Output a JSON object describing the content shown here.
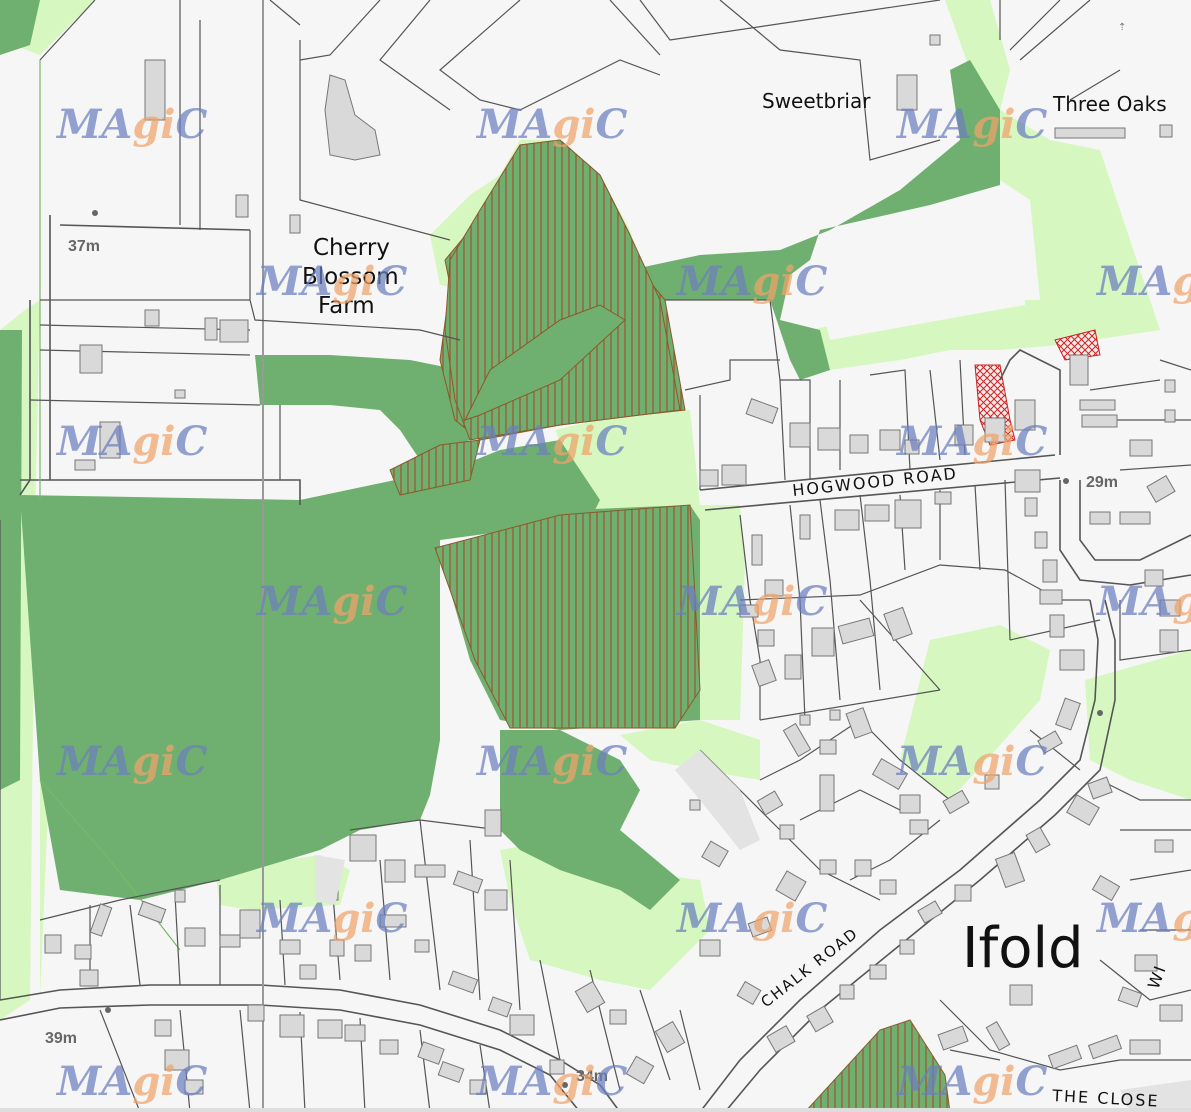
{
  "map": {
    "place_labels": {
      "sweetbriar": "Sweetbriar",
      "three_oaks": "Three Oaks",
      "cherry_1": "Cherry",
      "cherry_2": "Blossom",
      "cherry_3": "Farm",
      "ifold": "Ifold"
    },
    "road_labels": {
      "hogwood": "HOGWOOD ROAD",
      "chalk": "CHALK ROAD",
      "the_close": "THE CLOSE",
      "wi": "WI"
    },
    "spot_heights": {
      "h37": "37m",
      "h29": "29m",
      "h39": "39m",
      "h34": "34m"
    },
    "watermark": {
      "part1": "MA",
      "part2": "gi",
      "part3": "C"
    },
    "colors": {
      "background": "#f6f6f6",
      "woodland_dark": "#6faf6f",
      "greenspace_light": "#d6f7c0",
      "building": "#d9d9d9",
      "hatch_brown": "#a0522d",
      "hatch_red": "#cc2222",
      "watermark_blue": "#6b7fbf",
      "watermark_orange": "#f0a36a"
    }
  }
}
